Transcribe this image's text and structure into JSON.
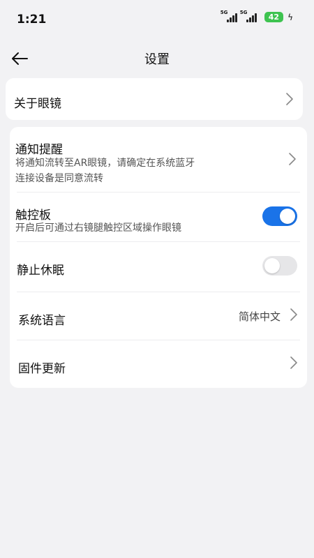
{
  "status_bar": {
    "time": "1:21",
    "network_1": "5G",
    "network_2": "5G",
    "battery": "42"
  },
  "header": {
    "title": "设置"
  },
  "about": {
    "label": "关于眼镜"
  },
  "settings": {
    "notification": {
      "title": "通知提醒",
      "subtitle_line1": "将通知流转至AR眼镜，请确定在系统蓝牙",
      "subtitle_line2": "连接设备是同意流转"
    },
    "touchpad": {
      "title": "触控板",
      "subtitle": "开启后可通过右镜腿触控区域操作眼镜",
      "enabled": true
    },
    "no_sleep": {
      "title": "静止休眠",
      "enabled": false
    },
    "language": {
      "title": "系统语言",
      "value": "简体中文"
    },
    "firmware": {
      "title": "固件更新"
    }
  },
  "colors": {
    "accent": "#1a73e8",
    "battery": "#3ec350",
    "background": "#f2f2f4"
  }
}
